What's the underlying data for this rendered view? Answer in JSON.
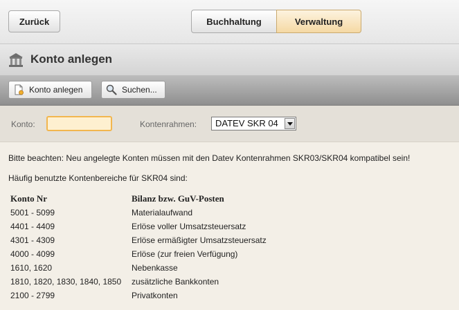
{
  "nav": {
    "back_label": "Zurück",
    "tabs": [
      {
        "label": "Buchhaltung",
        "active": false
      },
      {
        "label": "Verwaltung",
        "active": true
      }
    ]
  },
  "header": {
    "title": "Konto anlegen",
    "icon": "bank-icon"
  },
  "toolbar": {
    "create_label": "Konto anlegen",
    "search_label": "Suchen..."
  },
  "form": {
    "konto_label": "Konto:",
    "konto_value": "",
    "kontenrahmen_label": "Kontenrahmen:",
    "kontenrahmen_selected": "DATEV SKR 04"
  },
  "content": {
    "notice": "Bitte beachten: Neu angelegte Konten müssen mit den Datev Kontenrahmen SKR03/SKR04 kompatibel sein!",
    "subtitle": "Häufig benutzte Kontenbereiche für SKR04 sind:",
    "table": {
      "headers": [
        "Konto Nr",
        "Bilanz bzw. GuV-Posten"
      ],
      "rows": [
        [
          "5001 - 5099",
          "Materialaufwand"
        ],
        [
          "4401 - 4409",
          "Erlöse voller Umsatzsteuersatz"
        ],
        [
          "4301 - 4309",
          "Erlöse ermäßigter Umsatzsteuersatz"
        ],
        [
          "4000 - 4099",
          "Erlöse (zur freien Verfügung)"
        ],
        [
          "1610, 1620",
          "Nebenkasse"
        ],
        [
          "1810, 1820, 1830, 1840, 1850",
          "zusätzliche Bankkonten"
        ],
        [
          "2100 - 2799",
          "Privatkonten"
        ]
      ]
    }
  },
  "colors": {
    "active_tab": "#f5d9a4",
    "input_border": "#f2b64e",
    "background": "#f3efe7"
  }
}
